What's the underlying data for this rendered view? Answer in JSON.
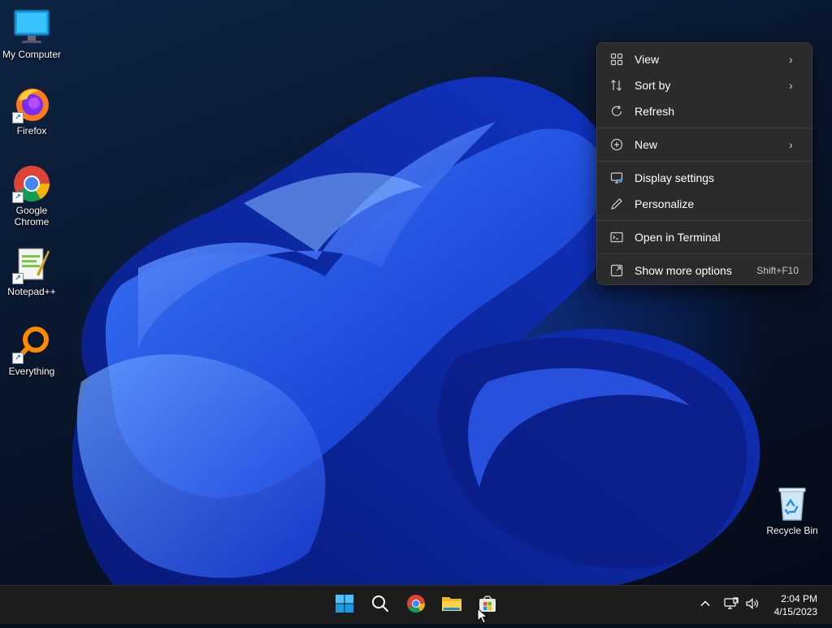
{
  "desktop": {
    "icons": [
      {
        "label": "My Computer",
        "icon": "computer-icon"
      },
      {
        "label": "Firefox",
        "icon": "firefox-icon"
      },
      {
        "label": "Google Chrome",
        "icon": "chrome-icon"
      },
      {
        "label": "Notepad++",
        "icon": "notepadpp-icon"
      },
      {
        "label": "Everything",
        "icon": "everything-icon"
      },
      {
        "label": "Recycle Bin",
        "icon": "recycle-bin-icon"
      }
    ]
  },
  "context_menu": {
    "items": [
      {
        "label": "View",
        "icon": "grid-icon",
        "submenu": true
      },
      {
        "label": "Sort by",
        "icon": "sort-icon",
        "submenu": true
      },
      {
        "label": "Refresh",
        "icon": "refresh-icon"
      },
      {
        "label": "New",
        "icon": "plus-circle-icon",
        "submenu": true
      },
      {
        "label": "Display settings",
        "icon": "display-icon"
      },
      {
        "label": "Personalize",
        "icon": "pen-icon"
      },
      {
        "label": "Open in Terminal",
        "icon": "terminal-icon"
      },
      {
        "label": "Show more options",
        "icon": "expand-icon",
        "shortcut": "Shift+F10"
      }
    ]
  },
  "taskbar": {
    "apps": [
      {
        "name": "Start",
        "icon": "windows-start-icon"
      },
      {
        "name": "Search",
        "icon": "search-icon"
      },
      {
        "name": "Google Chrome",
        "icon": "chrome-icon"
      },
      {
        "name": "File Explorer",
        "icon": "folder-icon"
      },
      {
        "name": "Microsoft Store",
        "icon": "store-icon"
      }
    ],
    "tray": {
      "time": "2:04 PM",
      "date": "4/15/2023"
    }
  },
  "colors": {
    "accent": "#1f7bd6",
    "menu_bg": "#2b2b2b",
    "taskbar_bg": "#1c1c1c"
  }
}
